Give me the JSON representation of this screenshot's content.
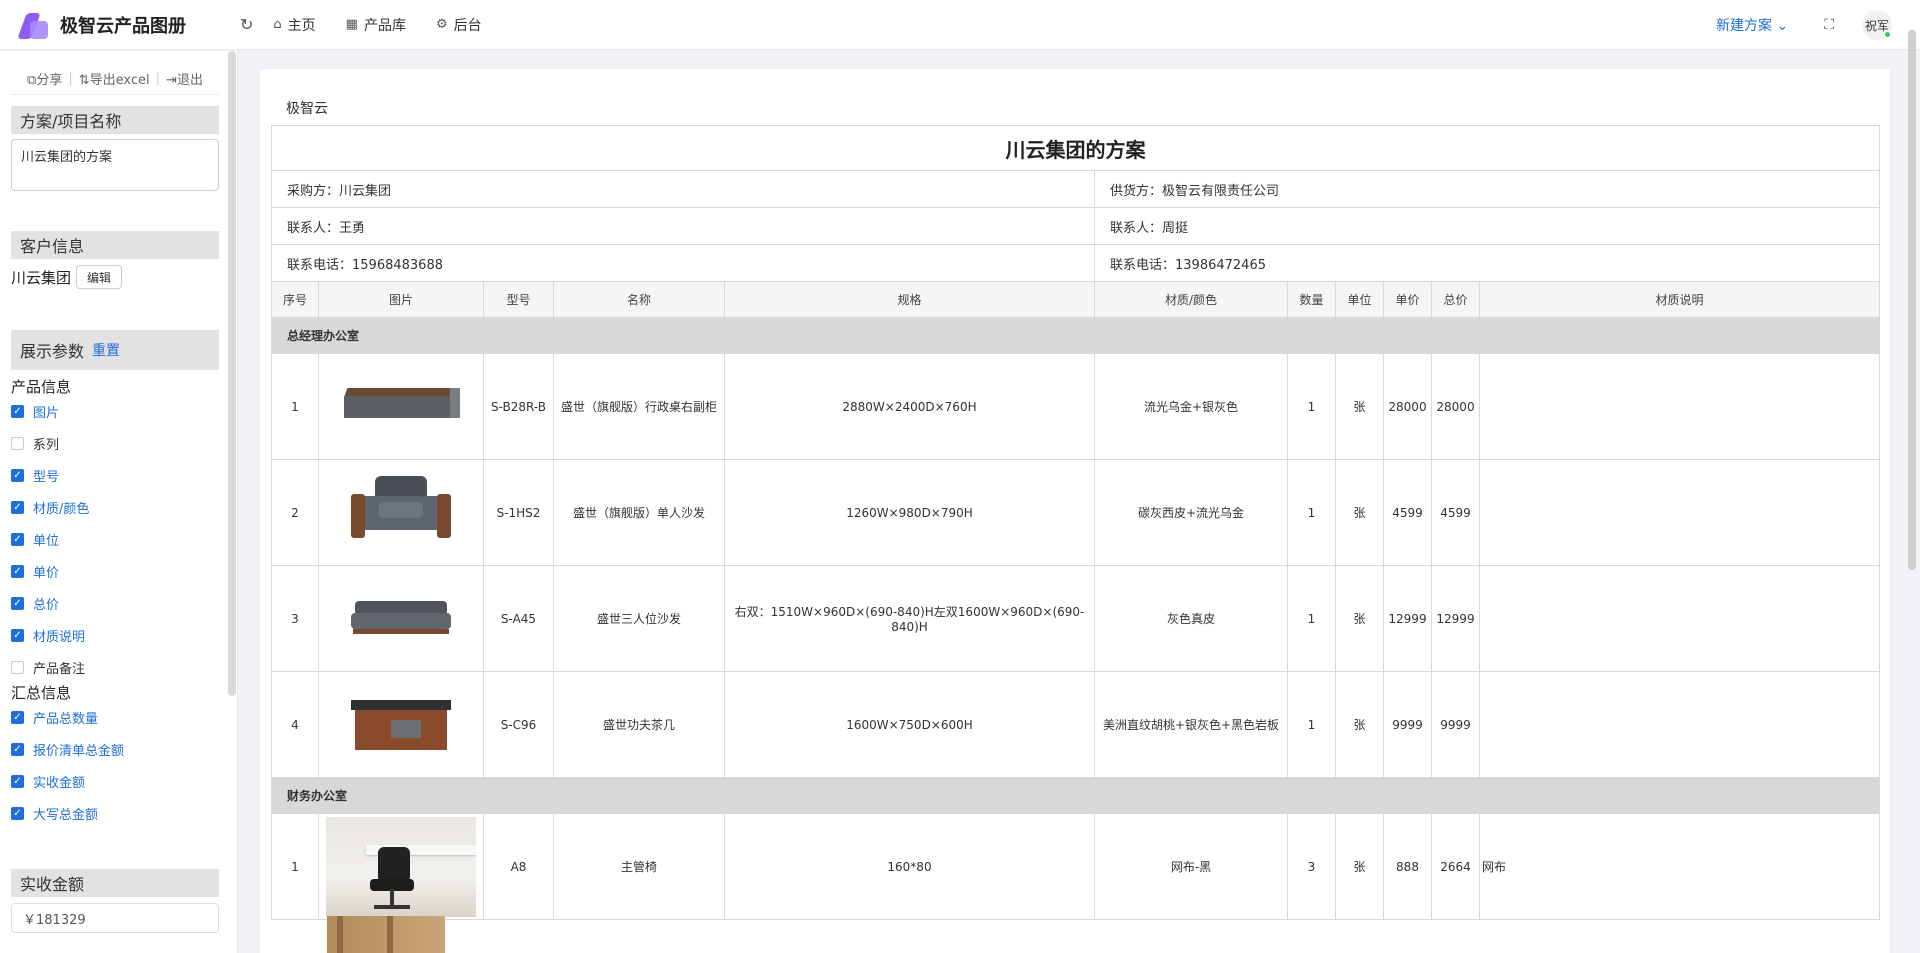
{
  "app": {
    "brand_name": "极智云产品图册"
  },
  "nav": {
    "items": [
      {
        "label": "主页"
      },
      {
        "label": "产品库"
      },
      {
        "label": "后台"
      }
    ],
    "new_plan": "新建方案",
    "user": "祝军"
  },
  "sidebar": {
    "actions": {
      "share": "分享",
      "export": "导出excel",
      "logout": "退出"
    },
    "plan_section": "方案/项目名称",
    "plan_name": "川云集团的方案",
    "customer_section": "客户信息",
    "customer_name": "川云集团",
    "edit_label": "编辑",
    "params_section": "展示参数",
    "reset_label": "重置",
    "product_info_title": "产品信息",
    "product_params": [
      {
        "label": "图片",
        "checked": true
      },
      {
        "label": "系列",
        "checked": false
      },
      {
        "label": "型号",
        "checked": true
      },
      {
        "label": "材质/颜色",
        "checked": true
      },
      {
        "label": "单位",
        "checked": true
      },
      {
        "label": "单价",
        "checked": true
      },
      {
        "label": "总价",
        "checked": true
      },
      {
        "label": "材质说明",
        "checked": true
      },
      {
        "label": "产品备注",
        "checked": false
      }
    ],
    "summary_title": "汇总信息",
    "summary_params": [
      {
        "label": "产品总数量",
        "checked": true
      },
      {
        "label": "报价清单总金额",
        "checked": true
      },
      {
        "label": "实收金额",
        "checked": true
      },
      {
        "label": "大写总金额",
        "checked": true
      }
    ],
    "amount_section": "实收金额",
    "amount_value": "￥181329"
  },
  "doc": {
    "company": "极智云",
    "title": "川云集团的方案",
    "buyer": "采购方：川云集团",
    "supplier": "供货方：极智云有限责任公司",
    "buyer_contact": "联系人：王勇",
    "supplier_contact": "联系人：周挺",
    "buyer_phone": "联系电话：15968483688",
    "supplier_phone": "联系电话：13986472465",
    "columns": [
      "序号",
      "图片",
      "型号",
      "名称",
      "规格",
      "材质/颜色",
      "数量",
      "单位",
      "单价",
      "总价",
      "材质说明"
    ],
    "groups": [
      {
        "name": "总经理办公室",
        "rows": [
          {
            "no": "1",
            "image": "desk-image",
            "model": "S-B28R-B",
            "name": "盛世（旗舰版）行政桌右副柜",
            "spec": "2880W×2400D×760H",
            "material": "流光乌金+银灰色",
            "qty": "1",
            "unit": "张",
            "price": "28000",
            "total": "28000",
            "note": ""
          },
          {
            "no": "2",
            "image": "armchair-image",
            "model": "S-1HS2",
            "name": "盛世（旗舰版）单人沙发",
            "spec": "1260W×980D×790H",
            "material": "碳灰西皮+流光乌金",
            "qty": "1",
            "unit": "张",
            "price": "4599",
            "total": "4599",
            "note": ""
          },
          {
            "no": "3",
            "image": "sofa-image",
            "model": "S-A45",
            "name": "盛世三人位沙发",
            "spec": "右双：1510W×960D×(690-840)H左双1600W×960D×(690-840)H",
            "material": "灰色真皮",
            "qty": "1",
            "unit": "张",
            "price": "12999",
            "total": "12999",
            "note": ""
          },
          {
            "no": "4",
            "image": "tea-table-image",
            "model": "S-C96",
            "name": "盛世功夫茶几",
            "spec": "1600W×750D×600H",
            "material": "美洲直纹胡桃+银灰色+黑色岩板",
            "qty": "1",
            "unit": "张",
            "price": "9999",
            "total": "9999",
            "note": ""
          }
        ]
      },
      {
        "name": "财务办公室",
        "rows": [
          {
            "no": "1",
            "image": "chair-photo",
            "model": "A8",
            "name": "主管椅",
            "spec": "160*80",
            "material": "网布-黑",
            "qty": "3",
            "unit": "张",
            "price": "888",
            "total": "2664",
            "note": "网布"
          }
        ]
      }
    ]
  }
}
